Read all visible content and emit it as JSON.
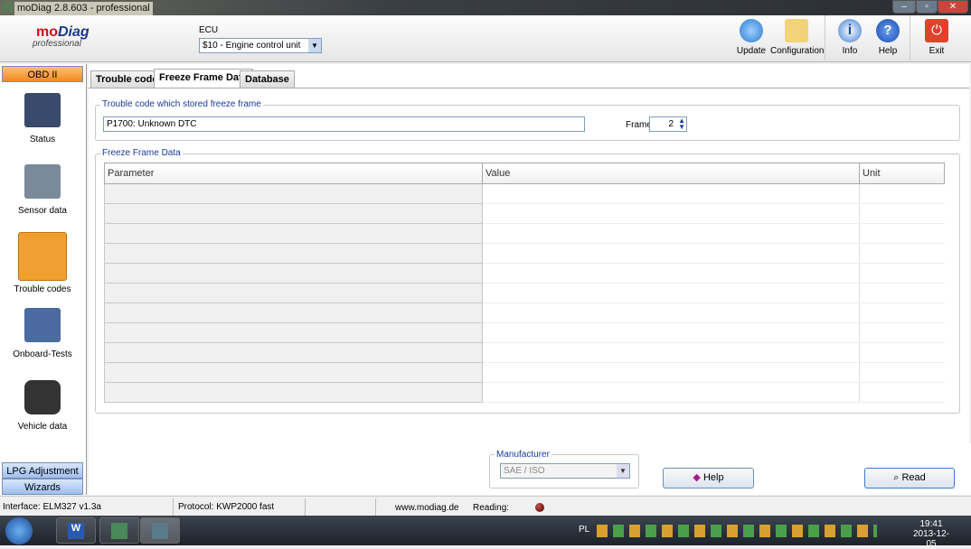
{
  "window": {
    "title": "moDiag 2.8.603 - professional"
  },
  "logo": {
    "mo": "mo",
    "diag": "Diag",
    "edition": "professional"
  },
  "ecu": {
    "label": "ECU",
    "value": "$10 - Engine control unit"
  },
  "toolbar": [
    {
      "label": "Update",
      "icon": "globe-computer-icon"
    },
    {
      "label": "Configuration",
      "icon": "folder-tools-icon"
    },
    {
      "label": "Info",
      "icon": "info-icon"
    },
    {
      "label": "Help",
      "icon": "help-icon"
    },
    {
      "label": "Exit",
      "icon": "power-icon"
    }
  ],
  "sidebar": {
    "header": "OBD II",
    "items": [
      {
        "label": "Status"
      },
      {
        "label": "Sensor data"
      },
      {
        "label": "Trouble codes"
      },
      {
        "label": "Onboard-Tests"
      },
      {
        "label": "Vehicle data"
      }
    ],
    "lpg": "LPG Adjustment",
    "wizards": "Wizards"
  },
  "tabs": [
    {
      "label": "Trouble codes"
    },
    {
      "label": "Freeze Frame Data"
    },
    {
      "label": "Database"
    }
  ],
  "trouble_group": {
    "title": "Trouble code which stored freeze frame",
    "code": "P1700: Unknown DTC",
    "frame_label": "Frame",
    "frame_value": "2"
  },
  "freeze_group": {
    "title": "Freeze Frame Data",
    "columns": [
      "Parameter",
      "Value",
      "Unit"
    ],
    "row_count": 11
  },
  "manufacturer": {
    "label": "Manufacturer",
    "value": "SAE / ISO"
  },
  "buttons": {
    "help": "Help",
    "read": "Read"
  },
  "status": {
    "interface": "Interface: ELM327 v1.3a",
    "protocol": "Protocol: KWP2000 fast",
    "website": "www.modiag.de",
    "reading": "Reading:"
  },
  "taskbar": {
    "lang": "PL",
    "time": "19:41",
    "date": "2013-12-05"
  }
}
